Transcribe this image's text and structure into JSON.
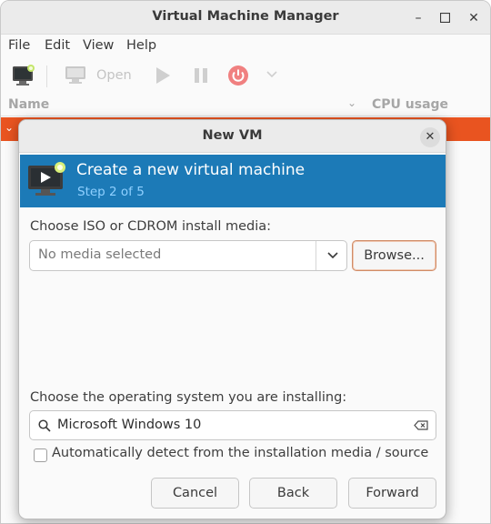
{
  "window": {
    "title": "Virtual Machine Manager"
  },
  "menu": {
    "file": "File",
    "edit": "Edit",
    "view": "View",
    "help": "Help"
  },
  "toolbar": {
    "open_label": "Open"
  },
  "vm_list": {
    "col_name": "Name",
    "col_cpu": "CPU usage"
  },
  "dialog": {
    "title": "New VM",
    "banner_title": "Create a new virtual machine",
    "banner_step": "Step 2 of 5",
    "media_label": "Choose ISO or CDROM install media:",
    "media_value": "No media selected",
    "browse_label": "Browse...",
    "os_label": "Choose the operating system you are installing:",
    "os_value": "Microsoft Windows 10",
    "autodetect_label": "Automatically detect from the installation media / source",
    "autodetect_checked": false,
    "cancel_label": "Cancel",
    "back_label": "Back",
    "forward_label": "Forward"
  },
  "colors": {
    "accent": "#e95420",
    "banner": "#1c7ab7",
    "step_text": "#8fd0ff"
  },
  "icons": [
    "new-vm-icon",
    "monitor-icon",
    "play-icon",
    "pause-icon",
    "power-icon",
    "chevron-down-icon",
    "search-icon",
    "clear-icon",
    "close-icon"
  ]
}
